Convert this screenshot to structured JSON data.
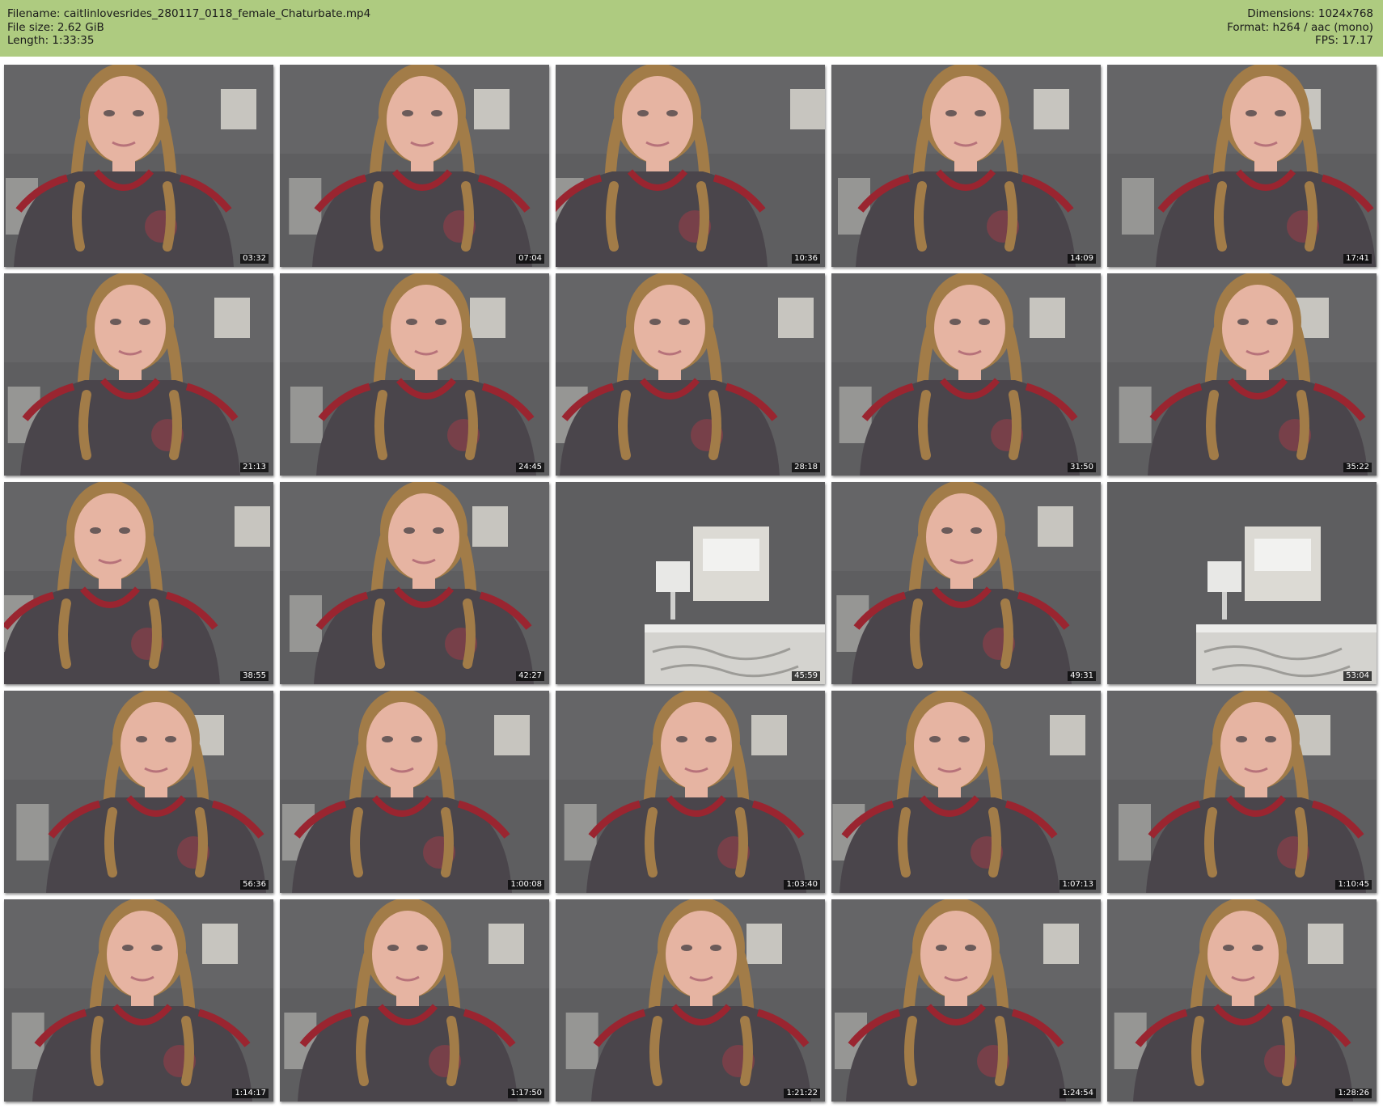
{
  "header": {
    "filename": "Filename: caitlinlovesrides_280117_0118_female_Chaturbate.mp4",
    "file_size": "File size: 2.62 GiB",
    "length": "Length: 1:33:35",
    "dimensions": "Dimensions: 1024x768",
    "format": "Format: h264 / aac (mono)",
    "fps": "FPS: 17.17"
  },
  "thumbnails": [
    {
      "time": "03:32",
      "scene": "person"
    },
    {
      "time": "07:04",
      "scene": "person"
    },
    {
      "time": "10:36",
      "scene": "person"
    },
    {
      "time": "14:09",
      "scene": "person"
    },
    {
      "time": "17:41",
      "scene": "person"
    },
    {
      "time": "21:13",
      "scene": "person"
    },
    {
      "time": "24:45",
      "scene": "person"
    },
    {
      "time": "28:18",
      "scene": "person"
    },
    {
      "time": "31:50",
      "scene": "person"
    },
    {
      "time": "35:22",
      "scene": "person"
    },
    {
      "time": "38:55",
      "scene": "person"
    },
    {
      "time": "42:27",
      "scene": "person"
    },
    {
      "time": "45:59",
      "scene": "room"
    },
    {
      "time": "49:31",
      "scene": "person"
    },
    {
      "time": "53:04",
      "scene": "room"
    },
    {
      "time": "56:36",
      "scene": "person"
    },
    {
      "time": "1:00:08",
      "scene": "person"
    },
    {
      "time": "1:03:40",
      "scene": "person"
    },
    {
      "time": "1:07:13",
      "scene": "person"
    },
    {
      "time": "1:10:45",
      "scene": "person"
    },
    {
      "time": "1:14:17",
      "scene": "person"
    },
    {
      "time": "1:17:50",
      "scene": "person"
    },
    {
      "time": "1:21:22",
      "scene": "person"
    },
    {
      "time": "1:24:54",
      "scene": "person"
    },
    {
      "time": "1:28:26",
      "scene": "person"
    }
  ],
  "colors": {
    "header_bg": "#aecb80",
    "wall": "#5e5e60",
    "shirt": "#4a454b",
    "shirt_trim": "#9a2530",
    "skin": "#e6b4a2",
    "hair": "#a27c48"
  }
}
